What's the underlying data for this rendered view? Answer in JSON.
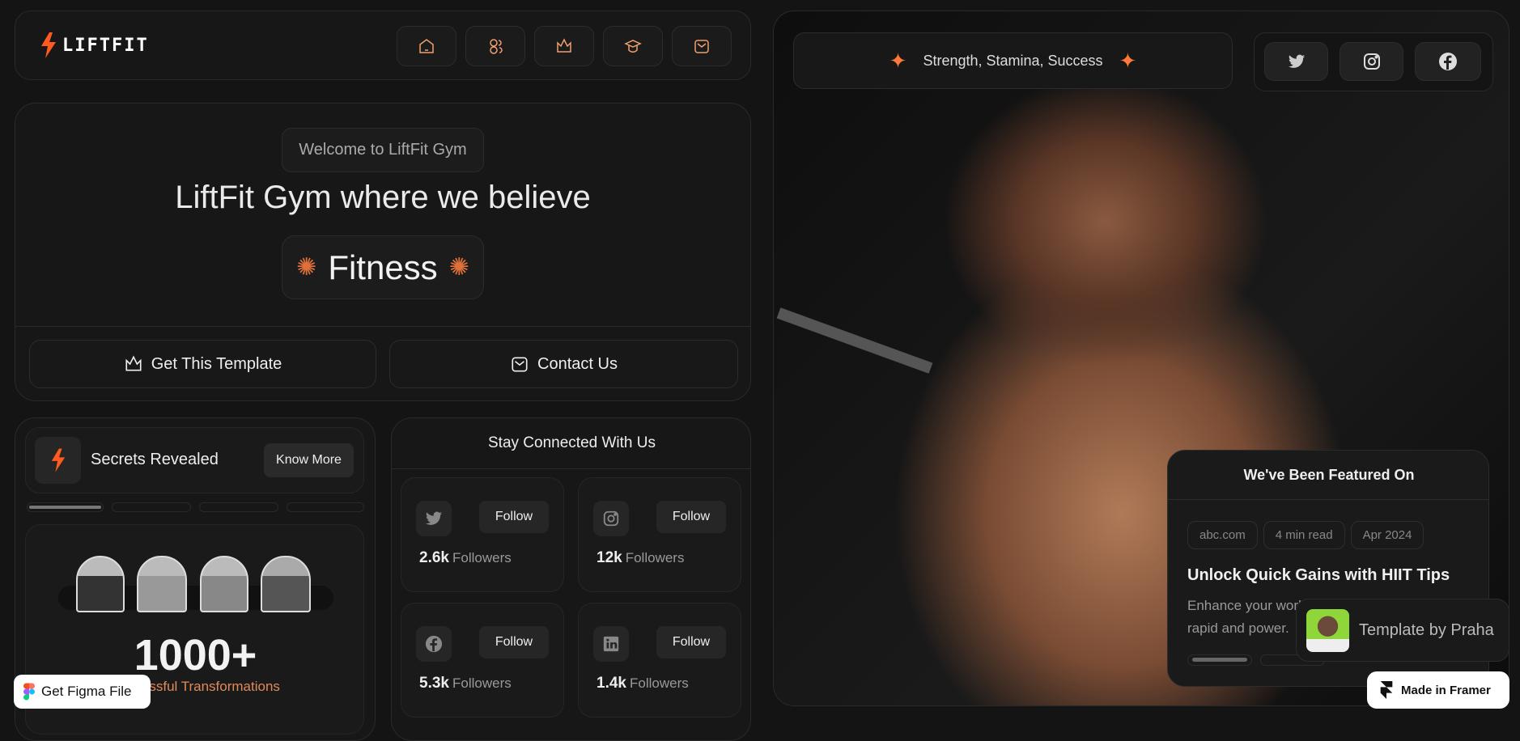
{
  "brand": {
    "name": "LIFTFIT",
    "accent": "#ff5a1f"
  },
  "nav": {
    "items": [
      {
        "icon": "home-icon"
      },
      {
        "icon": "users-icon"
      },
      {
        "icon": "crown-icon"
      },
      {
        "icon": "graduation-cap-icon"
      },
      {
        "icon": "mail-icon"
      }
    ]
  },
  "hero": {
    "welcome": "Welcome to LiftFit Gym",
    "headline": "LiftFit Gym where we believe",
    "word": "Fitness",
    "get_template": "Get This Template",
    "contact": "Contact Us"
  },
  "secrets": {
    "title": "Secrets Revealed",
    "button": "Know More",
    "count": "1000+",
    "caption": "Successful Transformations"
  },
  "social": {
    "title": "Stay Connected With Us",
    "items": [
      {
        "icon": "twitter-icon",
        "follow": "Follow",
        "count": "2.6k",
        "label": "Followers"
      },
      {
        "icon": "instagram-icon",
        "follow": "Follow",
        "count": "12k",
        "label": "Followers"
      },
      {
        "icon": "facebook-icon",
        "follow": "Follow",
        "count": "5.3k",
        "label": "Followers"
      },
      {
        "icon": "linkedin-icon",
        "follow": "Follow",
        "count": "1.4k",
        "label": "Followers"
      }
    ]
  },
  "right": {
    "tagline": "Strength, Stamina, Success"
  },
  "featured": {
    "title": "We've Been Featured On",
    "tags": [
      "abc.com",
      "4 min read",
      "Apr 2024"
    ],
    "headline": "Unlock Quick Gains with HIIT Tips",
    "body_line1": "Enhance your workout routine with high",
    "body_line2": "rapid and power."
  },
  "badges": {
    "figma": "Get Figma File",
    "author": "Template by Praha",
    "framer": "Made in Framer"
  }
}
